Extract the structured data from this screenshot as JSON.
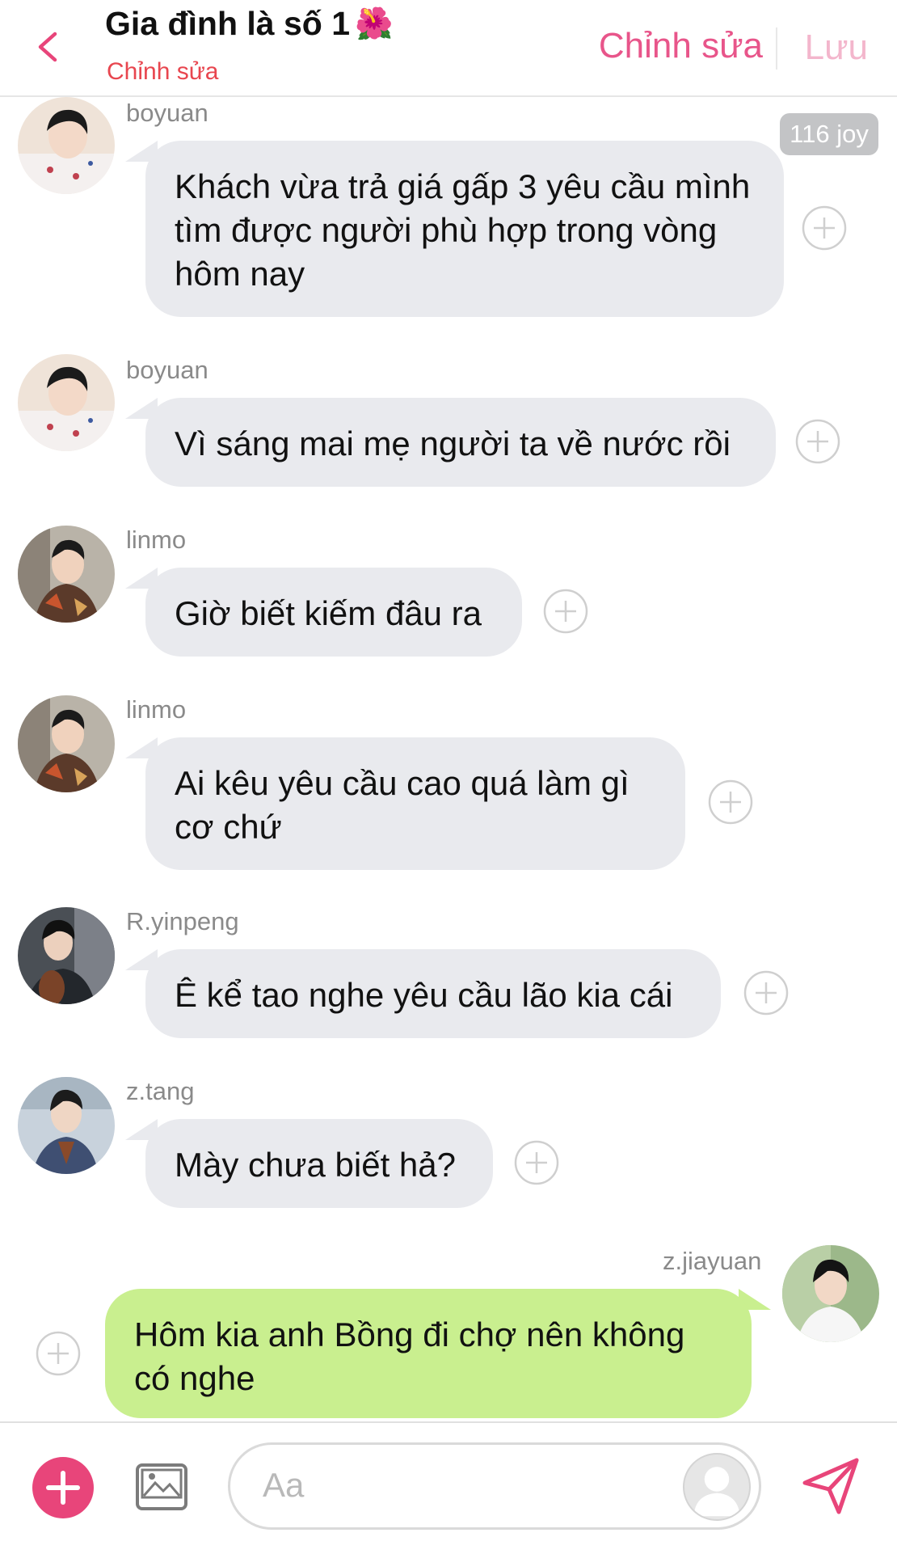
{
  "header": {
    "title": "Gia đình là số 1",
    "title_emoji": "🌺",
    "subtitle": "Chỉnh sửa",
    "edit_label": "Chỉnh sửa",
    "save_label": "Lưu"
  },
  "joy_badge": "116 joy",
  "messages": [
    {
      "sender": "boyuan",
      "text": "Khách vừa trả giá gấp 3 yêu cầu mình tìm được người phù hợp trong vòng hôm nay"
    },
    {
      "sender": "boyuan",
      "text": "Vì sáng mai mẹ người ta về nước rồi"
    },
    {
      "sender": "linmo",
      "text": "Giờ biết kiếm đâu ra"
    },
    {
      "sender": "linmo",
      "text": "Ai kêu yêu cầu cao quá làm gì cơ chứ"
    },
    {
      "sender": "R.yinpeng",
      "text": "Ê kể tao nghe yêu cầu lão kia cái"
    },
    {
      "sender": "z.tang",
      "text": "Mày chưa biết hả?"
    },
    {
      "sender": "z.jiayuan",
      "text": "Hôm kia anh Bồng đi chợ nên không có nghe"
    }
  ],
  "composer": {
    "placeholder": "Aa"
  },
  "colors": {
    "accent_pink": "#e8457a",
    "bubble_left": "#e9eaee",
    "bubble_right": "#c9ef8f"
  },
  "icons": [
    "back-chevron-icon",
    "add-reaction-icon",
    "plus-circle-icon",
    "image-icon",
    "send-icon",
    "default-avatar-icon"
  ]
}
